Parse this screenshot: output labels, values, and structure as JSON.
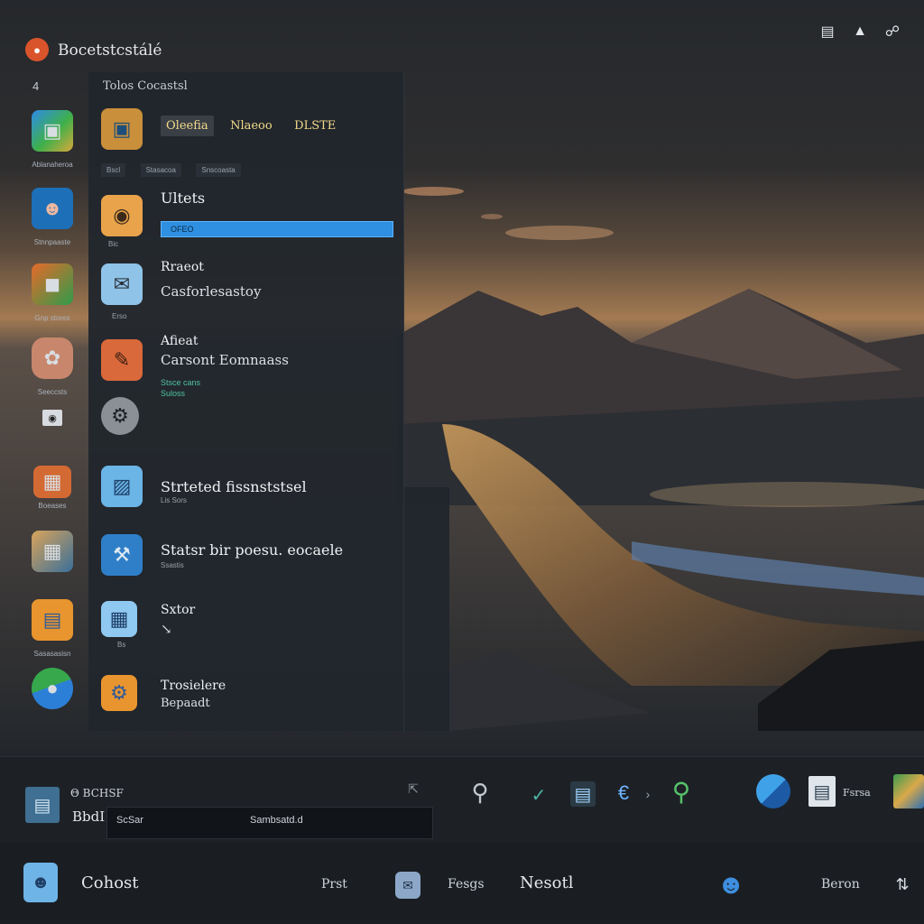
{
  "topbar": {
    "title": "Bocetstcstálé",
    "tray_icons": [
      "network-icon",
      "volume-icon",
      "link-icon"
    ]
  },
  "left_strip": {
    "top_label": "4",
    "items": [
      {
        "icon": "maps-app-icon",
        "label": "Ablanaheroa"
      },
      {
        "icon": "profile-app-icon",
        "label": "Stnnpaaste"
      },
      {
        "icon": "photos-app-icon",
        "label": "Gnp stores"
      },
      {
        "icon": "gallery-app-icon",
        "label": "Seeccsts"
      },
      {
        "icon": "camera-app-icon",
        "label": ""
      },
      {
        "icon": "store-app-icon",
        "label": "Boeases"
      },
      {
        "icon": "map-folder-icon",
        "label": ""
      },
      {
        "icon": "files-app-icon",
        "label": "Sasasasisn"
      },
      {
        "icon": "earth-app-icon",
        "label": ""
      }
    ]
  },
  "menu": {
    "header": "Tolos Cocastsl",
    "items": [
      {
        "chips": [
          "Oleefia",
          "Nlaeoo",
          "DLSTE"
        ],
        "tags": [
          "Bscl",
          "Stasacoa",
          "Snscoasta"
        ]
      },
      {
        "title": "Ultets",
        "sub": "Bic",
        "progress_text": "OFEO"
      },
      {
        "title": "Rraeot",
        "desc": "Casforlesastoy",
        "sub": "Erso"
      },
      {
        "title": "Afieat",
        "desc": "Carsont Eomnaass",
        "note": "Stsce cans\nSuloss"
      },
      {
        "title": "Strteted fissnststsel",
        "sub": "Lis Sors"
      },
      {
        "title": "Statsr bir poesu. eocaele",
        "sub": "Ssastis"
      },
      {
        "title": "Sxtor",
        "desc": "↘",
        "sub": "Bs"
      },
      {
        "title": "Trosielere",
        "desc": "Bepaadt"
      }
    ]
  },
  "taskbar": {
    "row1": {
      "app_label": "Θ BCHSF",
      "app_sub": "BbdI",
      "search_placeholder": "ScSar",
      "search_hint": "Sambsatd.d",
      "tray_text": "Fsrsa"
    },
    "row2": {
      "start_label": "Cohost",
      "item1": "Prst",
      "item2": "Fesgs",
      "item3": "Nesotl",
      "item4": "Beron"
    }
  }
}
